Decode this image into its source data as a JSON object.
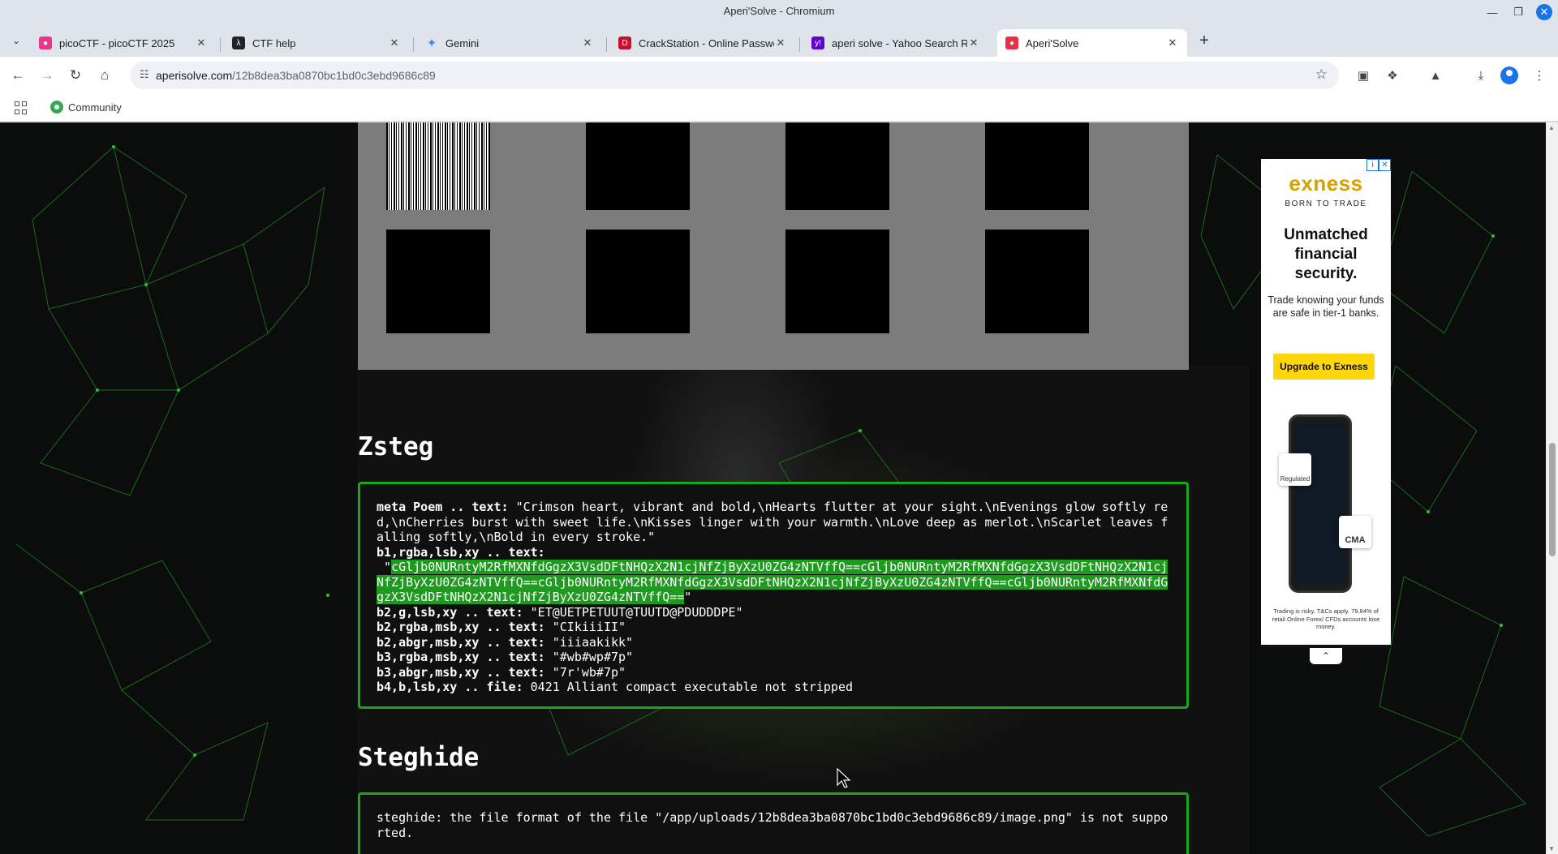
{
  "window": {
    "title": "Aperi'Solve - Chromium"
  },
  "tabs": [
    {
      "label": "picoCTF - picoCTF 2025",
      "color": "#e6398c"
    },
    {
      "label": "CTF help",
      "color": "#222222"
    },
    {
      "label": "Gemini",
      "color": "#4285f4"
    },
    {
      "label": "CrackStation - Online Passwo",
      "color": "#c8102e"
    },
    {
      "label": "aperi solve - Yahoo Search Re",
      "color": "#6001d2"
    },
    {
      "label": "Aperi'Solve",
      "color": "#e8304a"
    }
  ],
  "address_bar": {
    "host": "aperisolve.com",
    "path": "/12b8dea3ba0870bc1bd0c3ebd9686c89"
  },
  "bookmarks": [
    {
      "label": "Community"
    }
  ],
  "zsteg": {
    "title": "Zsteg",
    "lines": [
      {
        "key": "meta Poem .. text:",
        "value": " \"Crimson heart, vibrant and bold,\\nHearts flutter at your sight.\\nEvenings glow softly red,\\nCherries burst with sweet life.\\nKisses linger with your warmth.\\nLove deep as merlot.\\nScarlet leaves falling softly,\\nBold in every stroke.\""
      },
      {
        "key": "b1,rgba,lsb,xy .. text:",
        "value_pre": " \"",
        "value_hl": "cGljb0NURntyM2RfMXNfdGgzX3VsdDFtNHQzX2N1cjNfZjByXzU0ZG4zNTVffQ==cGljb0NURntyM2RfMXNfdGgzX3VsdDFtNHQzX2N1cjNfZjByXzU0ZG4zNTVffQ==cGljb0NURntyM2RfMXNfdGgzX3VsdDFtNHQzX2N1cjNfZjByXzU0ZG4zNTVffQ==cGljb0NURntyM2RfMXNfdGgzX3VsdDFtNHQzX2N1cjNfZjByXzU0ZG4zNTVffQ==",
        "value_post": "\""
      },
      {
        "key": "b2,g,lsb,xy .. text:",
        "value": " \"ET@UETPETUUT@TUUTD@PDUDDDPE\""
      },
      {
        "key": "b2,rgba,msb,xy .. text:",
        "value": " \"CIkiiiII\""
      },
      {
        "key": "b2,abgr,msb,xy .. text:",
        "value": " \"iiiaakikk\""
      },
      {
        "key": "b3,rgba,msb,xy .. text:",
        "value": " \"#wb#wp#7p\""
      },
      {
        "key": "b3,abgr,msb,xy .. text:",
        "value": " \"7r'wb#7p\""
      },
      {
        "key": "b4,b,lsb,xy .. file:",
        "value": " 0421 Alliant compact executable not stripped"
      }
    ]
  },
  "steghide": {
    "title": "Steghide",
    "text": "steghide: the file format of the file \"/app/uploads/12b8dea3ba0870bc1bd0c3ebd9686c89/image.png\" is not supported."
  },
  "ad": {
    "brand": "exness",
    "tagline": "BORN TO TRADE",
    "headline": "Unmatched financial security.",
    "body": "Trade knowing your funds are safe in tier-1 banks.",
    "cta": "Upgrade to Exness",
    "chip_regulated": "Regulated",
    "chip_cma": "CMA",
    "disclaimer": "Trading is risky. T&Cs apply. 79.84% of retail Online Forex/ CFDs accounts lose money."
  }
}
